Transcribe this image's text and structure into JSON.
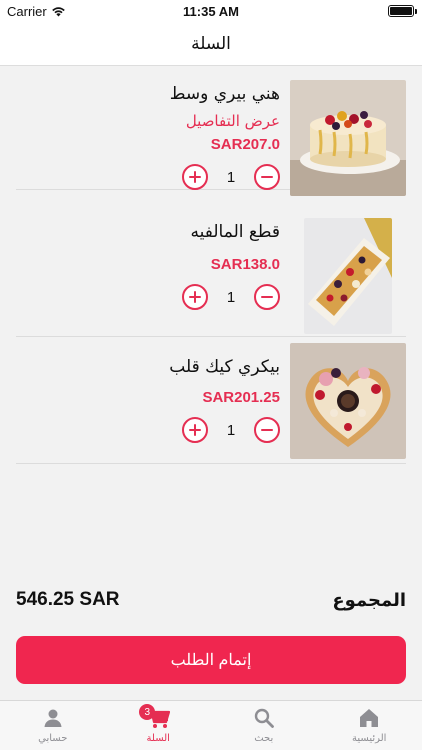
{
  "status_bar": {
    "carrier": "Carrier",
    "time": "11:35 AM"
  },
  "header": {
    "title": "السلة"
  },
  "cart": {
    "items": [
      {
        "name": "هني بيري وسط",
        "details_link": "عرض التفاصيل",
        "price": "SAR207.0",
        "quantity": "1",
        "image": "cake-berry-icon"
      },
      {
        "name": "قطع المالفيه",
        "details_link": "",
        "price": "SAR138.0",
        "quantity": "1",
        "image": "mille-feuille-box-icon"
      },
      {
        "name": "بيكري كيك قلب",
        "details_link": "",
        "price": "SAR201.25",
        "quantity": "1",
        "image": "heart-cake-icon"
      }
    ]
  },
  "summary": {
    "total_label": "المجموع",
    "total_value": "546.25 SAR"
  },
  "checkout": {
    "label": "إتمام الطلب"
  },
  "tabbar": {
    "tabs": [
      {
        "label": "حسابي",
        "icon": "person-icon"
      },
      {
        "label": "السلة",
        "icon": "cart-icon",
        "badge": "3"
      },
      {
        "label": "بحث",
        "icon": "search-icon"
      },
      {
        "label": "الرئيسية",
        "icon": "home-icon"
      }
    ]
  },
  "colors": {
    "accent": "#e52e52",
    "checkout_button": "#f0264f",
    "tab_inactive": "#8e8e93"
  }
}
